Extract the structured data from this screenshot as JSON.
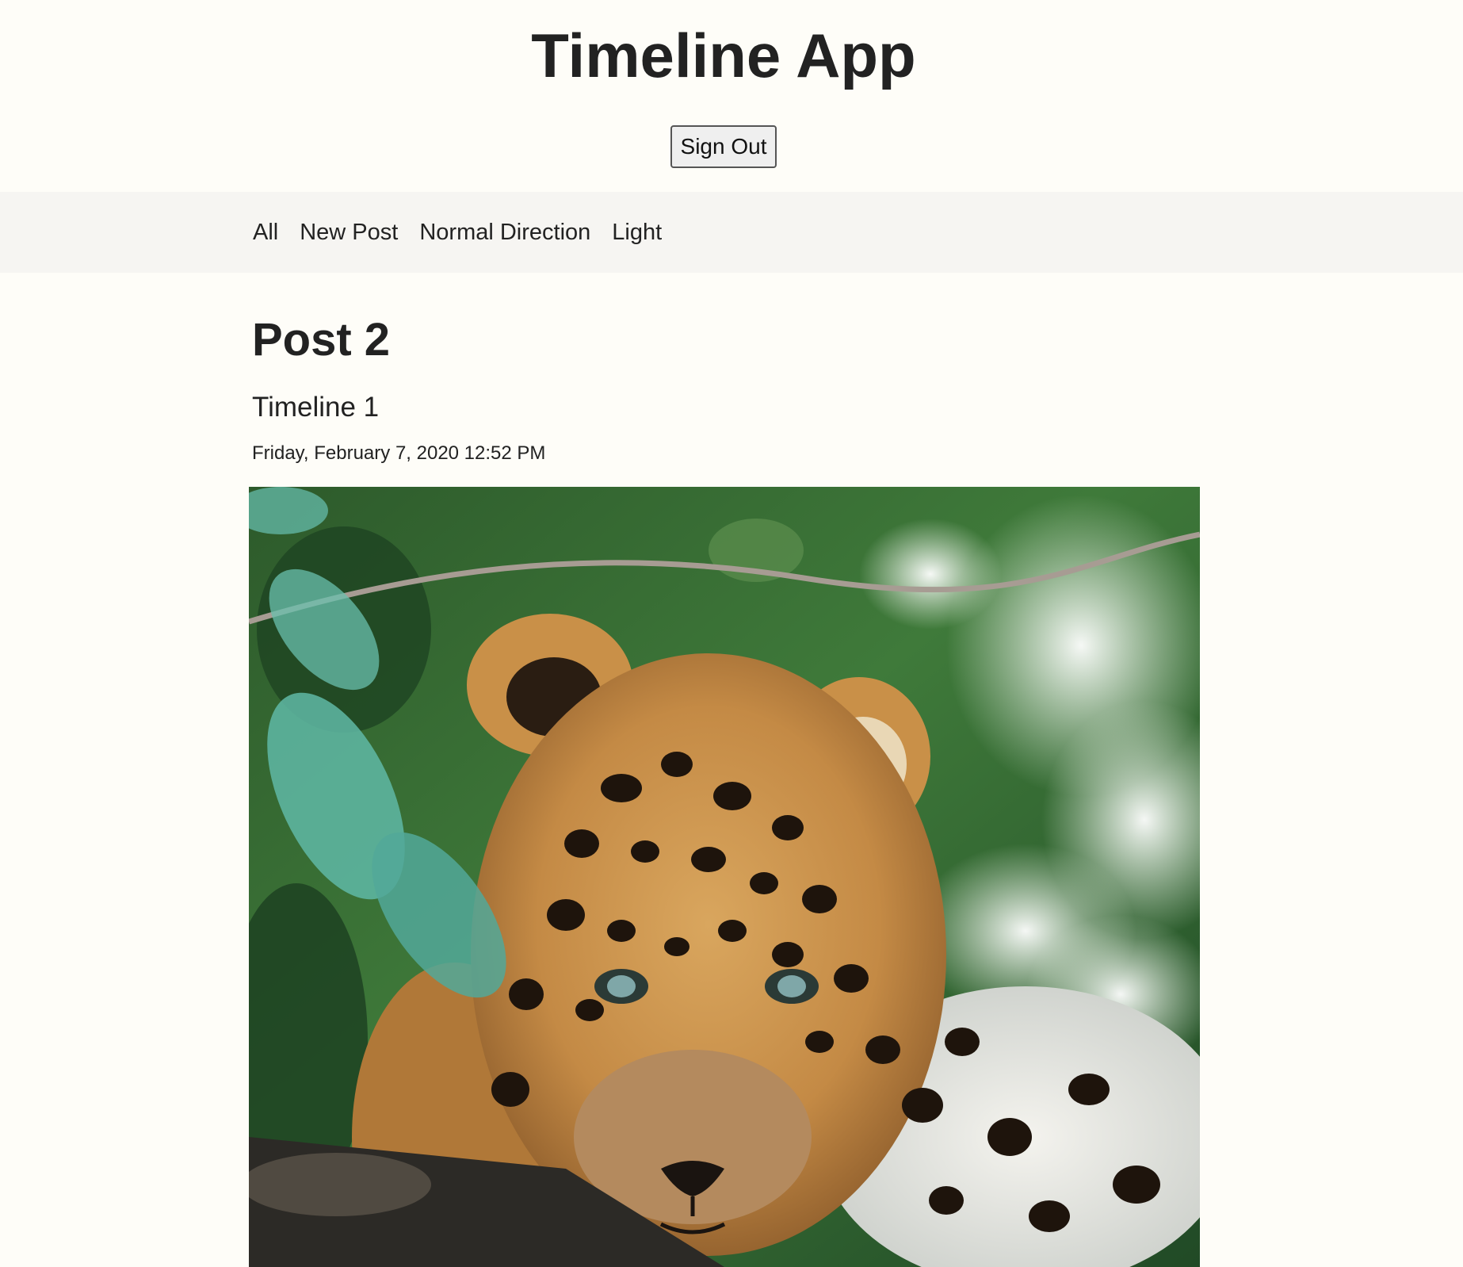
{
  "header": {
    "title": "Timeline App",
    "sign_out_label": "Sign Out"
  },
  "nav": {
    "items": [
      {
        "label": "All"
      },
      {
        "label": "New Post"
      },
      {
        "label": "Normal Direction"
      },
      {
        "label": "Light"
      }
    ]
  },
  "post": {
    "title": "Post 2",
    "timeline": "Timeline 1",
    "date": "Friday, February 7, 2020 12:52 PM",
    "image_subject": "leopard-photo"
  },
  "colors": {
    "background": "#fefdf8",
    "navbar": "#f6f5f2",
    "text": "#222222"
  }
}
